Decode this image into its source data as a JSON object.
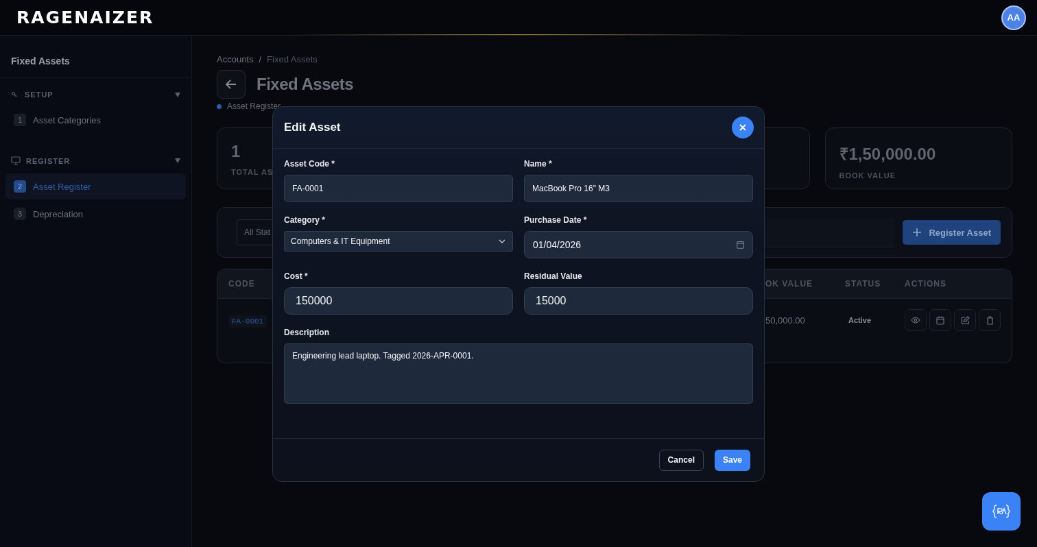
{
  "header": {
    "logo": "RAGENAIZER",
    "avatar": "AA"
  },
  "sidebar": {
    "title": "Fixed Assets",
    "sections": [
      {
        "label": "SETUP",
        "expanded": true,
        "items": [
          {
            "number": "1",
            "label": "Asset Categories",
            "selected": false
          }
        ]
      },
      {
        "label": "REGISTER",
        "expanded": true,
        "items": [
          {
            "number": "2",
            "label": "Asset Register",
            "selected": true
          },
          {
            "number": "3",
            "label": "Depreciation",
            "selected": false
          }
        ]
      }
    ]
  },
  "breadcrumb": [
    "Accounts",
    "/",
    "Fixed Assets"
  ],
  "page": {
    "title": "Fixed Assets",
    "subtitle": "Asset Register"
  },
  "stats": [
    {
      "value": "1",
      "label": "TOTAL AS"
    },
    {
      "value": "₹1,50,000.00",
      "label": "BOOK VALUE"
    }
  ],
  "filters": {
    "status_select": "All Stat",
    "register_button": "Register Asset"
  },
  "table": {
    "columns": [
      "CODE",
      "OK VALUE",
      "STATUS",
      "ACTIONS"
    ],
    "rows": [
      {
        "code": "FA-0001",
        "book_value": "50,000.00",
        "status": "Active"
      }
    ]
  },
  "modal": {
    "title": "Edit Asset",
    "fields": [
      {
        "label": "Asset Code *",
        "kind": "text",
        "value": "FA-0001"
      },
      {
        "label": "Name *",
        "kind": "text",
        "value": "MacBook Pro 16\" M3"
      },
      {
        "label": "Category *",
        "kind": "select",
        "value": "Computers & IT Equipment"
      },
      {
        "label": "Purchase Date *",
        "kind": "date",
        "value": "01/04/2026"
      },
      {
        "label": "Cost *",
        "kind": "number",
        "value": "150000"
      },
      {
        "label": "Residual Value",
        "kind": "number",
        "value": "15000"
      },
      {
        "label": "Description",
        "kind": "textarea",
        "value": "Engineering lead laptop. Tagged 2026-APR-0001."
      }
    ],
    "buttons": [
      {
        "label": "Cancel",
        "kind": "secondary"
      },
      {
        "label": "Save",
        "kind": "primary"
      }
    ]
  }
}
